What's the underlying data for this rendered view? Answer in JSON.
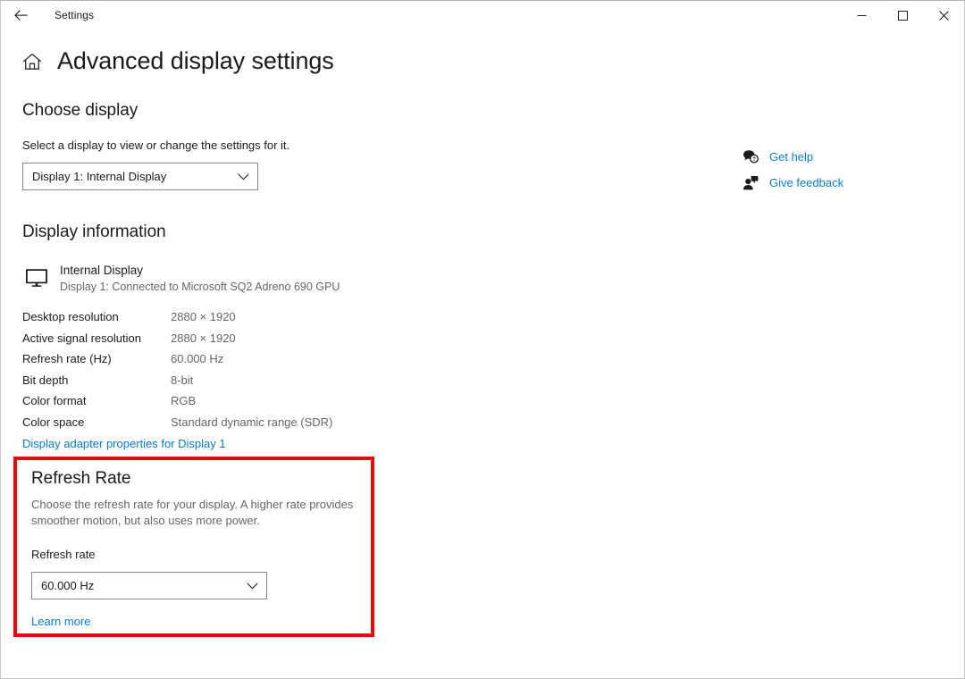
{
  "window": {
    "app_title": "Settings",
    "back_icon": "back-arrow-icon",
    "controls": {
      "minimize": "minimize-icon",
      "maximize": "maximize-icon",
      "close": "close-icon"
    }
  },
  "header": {
    "home_icon": "home-icon",
    "title": "Advanced display settings"
  },
  "choose_display": {
    "heading": "Choose display",
    "description": "Select a display to view or change the settings for it.",
    "dropdown": {
      "label": "display-select",
      "value": "Display 1: Internal Display",
      "chevron": "chevron-down-icon"
    }
  },
  "display_information": {
    "heading": "Display information",
    "device": {
      "icon": "monitor-icon",
      "name": "Internal Display",
      "subtitle": "Display 1: Connected to Microsoft SQ2 Adreno 690 GPU"
    },
    "rows": [
      {
        "key": "Desktop resolution",
        "value": "2880 × 1920"
      },
      {
        "key": "Active signal resolution",
        "value": "2880 × 1920"
      },
      {
        "key": "Refresh rate (Hz)",
        "value": "60.000 Hz"
      },
      {
        "key": "Bit depth",
        "value": "8-bit"
      },
      {
        "key": "Color format",
        "value": "RGB"
      },
      {
        "key": "Color space",
        "value": "Standard dynamic range (SDR)"
      }
    ],
    "adapter_link": "Display adapter properties for Display 1"
  },
  "refresh_rate": {
    "heading": "Refresh Rate",
    "description": "Choose the refresh rate for your display. A higher rate provides smoother motion, but also uses more power.",
    "field_label": "Refresh rate",
    "dropdown": {
      "value": "60.000 Hz",
      "chevron": "chevron-down-icon"
    },
    "learn_more": "Learn more",
    "highlight_color": "#fb0007"
  },
  "help": {
    "items": [
      {
        "icon": "question-bubble-icon",
        "label": "Get help"
      },
      {
        "icon": "feedback-person-icon",
        "label": "Give feedback"
      }
    ]
  },
  "colors": {
    "link": "#0a7ad4",
    "muted_text": "#666666",
    "primary_text": "#1b1b1b",
    "annotation": "#fb0007"
  }
}
